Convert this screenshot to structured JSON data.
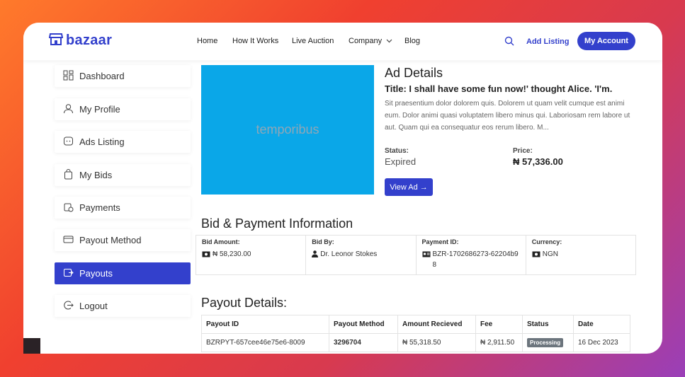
{
  "header": {
    "logo_text": "bazaar",
    "nav": [
      "Home",
      "How It Works",
      "Live Auction",
      "Company",
      "Blog"
    ],
    "add_listing": "Add Listing",
    "my_account": "My Account"
  },
  "sidebar": {
    "items": [
      {
        "label": "Dashboard",
        "icon": "dashboard-icon"
      },
      {
        "label": "My Profile",
        "icon": "user-icon"
      },
      {
        "label": "Ads Listing",
        "icon": "ads-icon"
      },
      {
        "label": "My Bids",
        "icon": "bag-icon"
      },
      {
        "label": "Payments",
        "icon": "payment-icon"
      },
      {
        "label": "Payout Method",
        "icon": "card-icon"
      },
      {
        "label": "Payouts",
        "icon": "payout-icon",
        "active": true
      },
      {
        "label": "Logout",
        "icon": "logout-icon"
      }
    ]
  },
  "ad": {
    "image_text": "temporibus",
    "heading": "Ad Details",
    "title": "Title: I shall have some fun now!' thought Alice. 'I'm.",
    "description": "Sit praesentium dolor dolorem quis. Dolorem ut quam velit cumque est animi eum. Dolor animi quasi voluptatem libero minus qui. Laboriosam rem labore ut aut. Quam qui ea consequatur eos rerum libero. M...",
    "status_label": "Status:",
    "status_value": "Expired",
    "price_label": "Price:",
    "price_value": "₦ 57,336.00",
    "view_button": "View Ad →"
  },
  "bid": {
    "heading": "Bid & Payment Information",
    "cells": [
      {
        "label": "Bid Amount:",
        "value": "₦ 58,230.00"
      },
      {
        "label": "Bid By:",
        "value": "Dr. Leonor Stokes"
      },
      {
        "label": "Payment ID:",
        "value": "BZR-1702686273-62204b98"
      },
      {
        "label": "Currency:",
        "value": "NGN"
      }
    ]
  },
  "payout": {
    "heading": "Payout Details:",
    "columns": [
      "Payout ID",
      "Payout Method",
      "Amount Recieved",
      "Fee",
      "Status",
      "Date"
    ],
    "rows": [
      [
        "BZRPYT-657cee46e75e6-8009",
        "3296704",
        "₦ 55,318.50",
        "₦ 2,911.50",
        "Processing",
        "16 Dec 2023"
      ]
    ]
  },
  "colors": {
    "accent": "#3340cc",
    "image_bg": "#0aa7e8",
    "badge": "#6c757d"
  }
}
